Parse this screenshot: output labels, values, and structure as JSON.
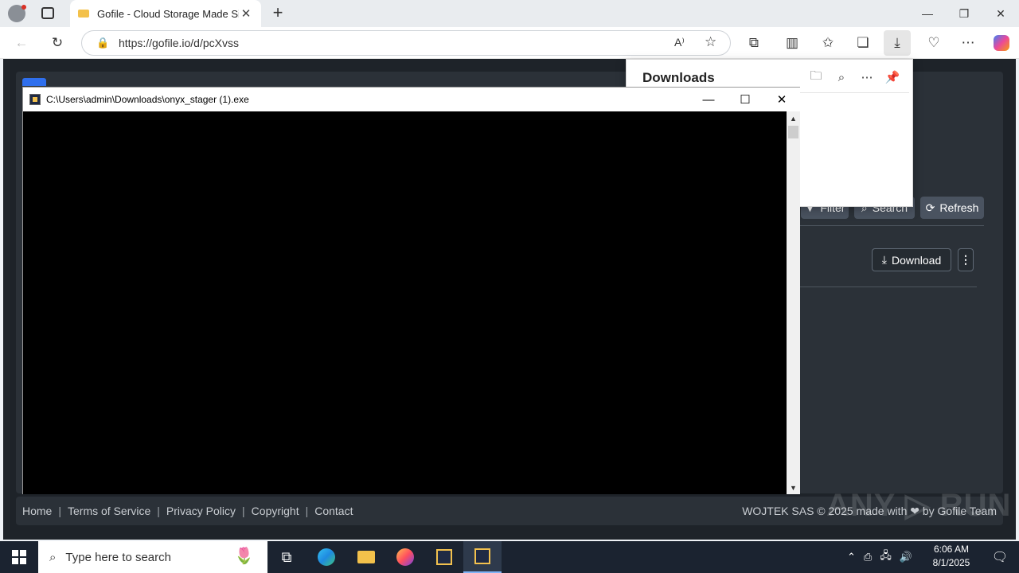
{
  "browser": {
    "tab_title": "Gofile - Cloud Storage Made Simple",
    "url": "https://gofile.io/d/pcXvss",
    "close_tab": "✕",
    "new_tab": "+"
  },
  "downloads_panel": {
    "title": "Downloads"
  },
  "page": {
    "filter_label": "Filter",
    "search_label": "Search",
    "refresh_label": "Refresh",
    "download_label": "Download",
    "footer_links": [
      "Home",
      "Terms of Service",
      "Privacy Policy",
      "Copyright",
      "Contact"
    ],
    "footer_right": "WOJTEK SAS © 2025 made with ❤ by Gofile Team"
  },
  "console": {
    "title": "C:\\Users\\admin\\Downloads\\onyx_stager (1).exe"
  },
  "watermark": "ANY ▷ RUN",
  "taskbar": {
    "search_placeholder": "Type here to search",
    "time": "6:06 AM",
    "date": "8/1/2025"
  }
}
